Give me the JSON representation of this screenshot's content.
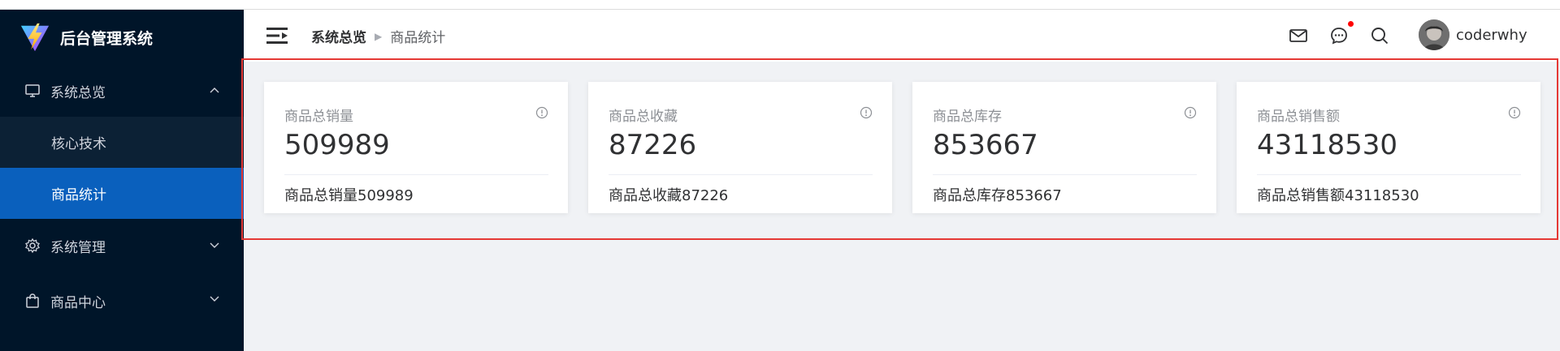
{
  "app": {
    "title": "后台管理系统",
    "logo_icon": "vite-logo-icon"
  },
  "sidebar": {
    "groups": [
      {
        "label": "系统总览",
        "icon": "monitor-icon",
        "expanded": true,
        "children": [
          {
            "label": "核心技术",
            "active": false
          },
          {
            "label": "商品统计",
            "active": true
          }
        ]
      },
      {
        "label": "系统管理",
        "icon": "gear-icon",
        "expanded": false
      },
      {
        "label": "商品中心",
        "icon": "bag-icon",
        "expanded": false
      }
    ],
    "colors": {
      "background": "#001529",
      "active": "#0a60bd"
    }
  },
  "header": {
    "breadcrumb": [
      "系统总览",
      "商品统计"
    ],
    "icons": [
      "mail-icon",
      "chat-icon",
      "search-icon"
    ],
    "username": "coderwhy"
  },
  "cards": [
    {
      "title": "商品总销量",
      "value": "509989",
      "footer": "商品总销量509989"
    },
    {
      "title": "商品总收藏",
      "value": "87226",
      "footer": "商品总收藏87226"
    },
    {
      "title": "商品总库存",
      "value": "853667",
      "footer": "商品总库存853667"
    },
    {
      "title": "商品总销售额",
      "value": "43118530",
      "footer": "商品总销售额43118530"
    }
  ]
}
